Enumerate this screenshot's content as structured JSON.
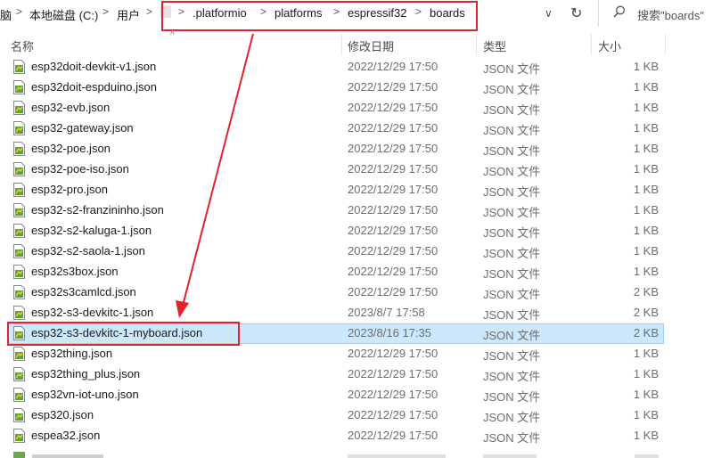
{
  "address": {
    "crumbs": [
      "脑",
      "本地磁盘 (C:)",
      "用户",
      ".platformio",
      "platforms",
      "espressif32",
      "boards"
    ],
    "separator": ">",
    "dropdown_icon": "chevron-down-icon",
    "refresh_icon": "refresh-icon",
    "search_placeholder": "搜索\"boards\""
  },
  "columns": {
    "name": "名称",
    "date": "修改日期",
    "type": "类型",
    "size": "大小"
  },
  "files": [
    {
      "name": "esp32doit-devkit-v1.json",
      "date": "2022/12/29 17:50",
      "type": "JSON 文件",
      "size": "1 KB"
    },
    {
      "name": "esp32doit-espduino.json",
      "date": "2022/12/29 17:50",
      "type": "JSON 文件",
      "size": "1 KB"
    },
    {
      "name": "esp32-evb.json",
      "date": "2022/12/29 17:50",
      "type": "JSON 文件",
      "size": "1 KB"
    },
    {
      "name": "esp32-gateway.json",
      "date": "2022/12/29 17:50",
      "type": "JSON 文件",
      "size": "1 KB"
    },
    {
      "name": "esp32-poe.json",
      "date": "2022/12/29 17:50",
      "type": "JSON 文件",
      "size": "1 KB"
    },
    {
      "name": "esp32-poe-iso.json",
      "date": "2022/12/29 17:50",
      "type": "JSON 文件",
      "size": "1 KB"
    },
    {
      "name": "esp32-pro.json",
      "date": "2022/12/29 17:50",
      "type": "JSON 文件",
      "size": "1 KB"
    },
    {
      "name": "esp32-s2-franzininho.json",
      "date": "2022/12/29 17:50",
      "type": "JSON 文件",
      "size": "1 KB"
    },
    {
      "name": "esp32-s2-kaluga-1.json",
      "date": "2022/12/29 17:50",
      "type": "JSON 文件",
      "size": "1 KB"
    },
    {
      "name": "esp32-s2-saola-1.json",
      "date": "2022/12/29 17:50",
      "type": "JSON 文件",
      "size": "1 KB"
    },
    {
      "name": "esp32s3box.json",
      "date": "2022/12/29 17:50",
      "type": "JSON 文件",
      "size": "1 KB"
    },
    {
      "name": "esp32s3camlcd.json",
      "date": "2022/12/29 17:50",
      "type": "JSON 文件",
      "size": "2 KB"
    },
    {
      "name": "esp32-s3-devkitc-1.json",
      "date": "2023/8/7 17:58",
      "type": "JSON 文件",
      "size": "2 KB"
    },
    {
      "name": "esp32-s3-devkitc-1-myboard.json",
      "date": "2023/8/16 17:35",
      "type": "JSON 文件",
      "size": "2 KB"
    },
    {
      "name": "esp32thing.json",
      "date": "2022/12/29 17:50",
      "type": "JSON 文件",
      "size": "1 KB"
    },
    {
      "name": "esp32thing_plus.json",
      "date": "2022/12/29 17:50",
      "type": "JSON 文件",
      "size": "1 KB"
    },
    {
      "name": "esp32vn-iot-uno.json",
      "date": "2022/12/29 17:50",
      "type": "JSON 文件",
      "size": "1 KB"
    },
    {
      "name": "esp320.json",
      "date": "2022/12/29 17:50",
      "type": "JSON 文件",
      "size": "1 KB"
    },
    {
      "name": "espea32.json",
      "date": "2022/12/29 17:50",
      "type": "JSON 文件",
      "size": "1 KB"
    }
  ],
  "selected_index": 13,
  "file_icon": "json-file-icon",
  "colors": {
    "annotation_red": "#e0242b",
    "selection_bg": "#cce8ff",
    "selection_border": "#99d1ff"
  }
}
